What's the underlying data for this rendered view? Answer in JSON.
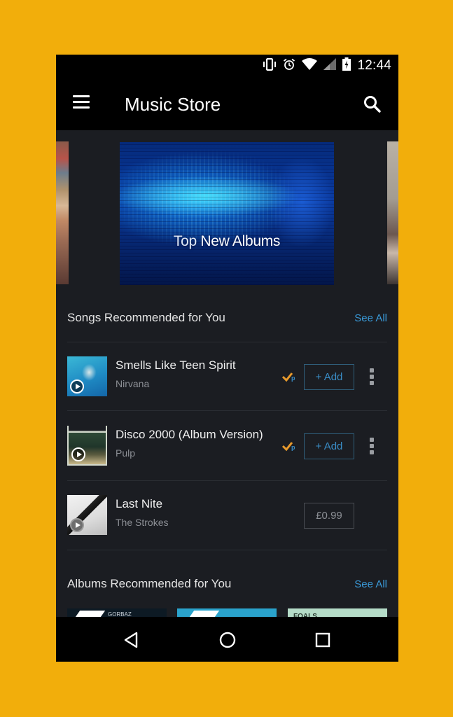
{
  "status_bar": {
    "time": "12:44",
    "icons": [
      "vibrate-icon",
      "alarm-icon",
      "wifi-icon",
      "signal-icon",
      "battery-charging-icon"
    ]
  },
  "app_bar": {
    "menu_icon": "hamburger-menu-icon",
    "title": "Music Store",
    "search_icon": "search-icon"
  },
  "carousel": {
    "hero_caption_light": "Top",
    "hero_caption_bold": "New Albums"
  },
  "songs_section": {
    "title": "Songs Recommended for You",
    "see_all": "See All",
    "songs": [
      {
        "title": "Smells Like Teen Spirit",
        "artist": "Nirvana",
        "prime": true,
        "action": "+ Add",
        "action_type": "add"
      },
      {
        "title": "Disco 2000 (Album Version)",
        "artist": "Pulp",
        "prime": true,
        "action": "+ Add",
        "action_type": "add"
      },
      {
        "title": "Last Nite",
        "artist": "The Strokes",
        "prime": false,
        "action": "£0.99",
        "action_type": "price"
      }
    ]
  },
  "albums_section": {
    "title": "Albums Recommended for You",
    "see_all": "See All",
    "album_tile_texts": [
      "GORBAZ",
      "",
      "FOALS"
    ]
  },
  "nav_bar": {
    "buttons": [
      "back-icon",
      "home-icon",
      "recents-icon"
    ]
  },
  "colors": {
    "background": "#f2ae0b",
    "screen": "#1b1d22",
    "accent": "#3a9ad9",
    "prime": "#e89a2c"
  }
}
